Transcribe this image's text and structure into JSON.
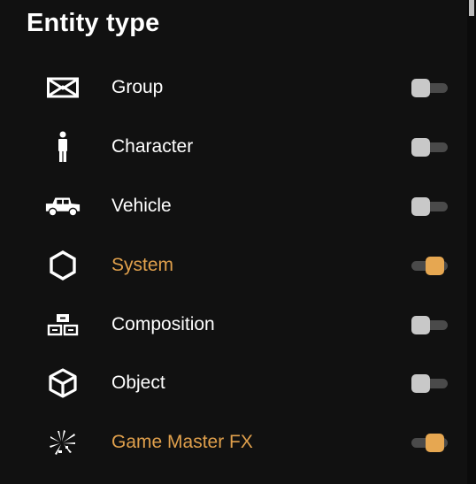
{
  "panel": {
    "title": "Entity type"
  },
  "colors": {
    "accent": "#e6a751",
    "text": "#ffffff",
    "background": "#111111",
    "toggle_off": "#c8c8c8",
    "track": "#4a4a4a"
  },
  "items": [
    {
      "label": "Group",
      "icon": "envelope-icon",
      "enabled": false
    },
    {
      "label": "Character",
      "icon": "person-icon",
      "enabled": false
    },
    {
      "label": "Vehicle",
      "icon": "jeep-icon",
      "enabled": false
    },
    {
      "label": "System",
      "icon": "hexagon-icon",
      "enabled": true
    },
    {
      "label": "Composition",
      "icon": "stacked-boxes-icon",
      "enabled": false
    },
    {
      "label": "Object",
      "icon": "cube-icon",
      "enabled": false
    },
    {
      "label": "Game Master FX",
      "icon": "explosion-icon",
      "enabled": true
    }
  ]
}
